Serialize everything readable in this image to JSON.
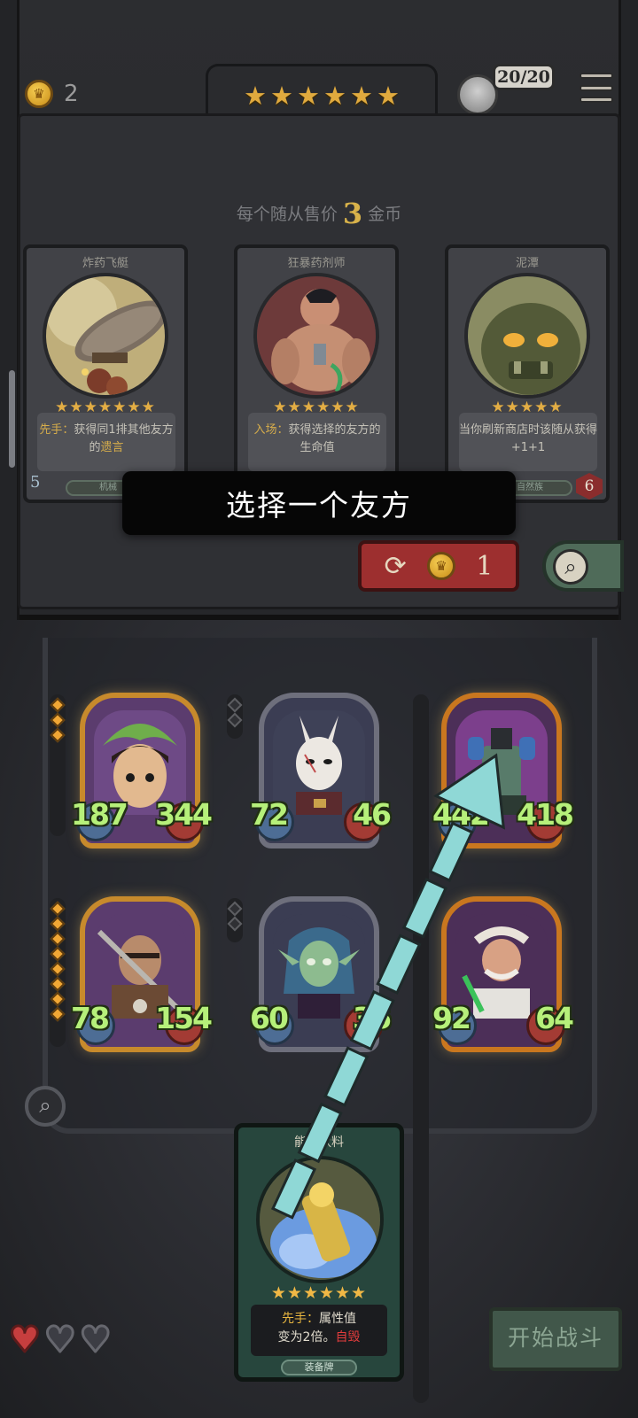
{
  "header": {
    "gold": "2",
    "tier_stars": [
      "★",
      "★",
      "★",
      "★",
      "★",
      "★"
    ],
    "hero_count": "20/20"
  },
  "shop": {
    "price_prefix": "每个随从售价",
    "price_value": "3",
    "price_suffix": "金币",
    "cards": [
      {
        "name": "炸药飞艇",
        "stars": "★★★★★★★",
        "desc_lead": "先手：",
        "desc_body": "获得同1排其他友方的",
        "desc_tail": "遗言",
        "cost": "5",
        "tribe": "机械"
      },
      {
        "name": "狂暴药剂师",
        "stars": "★★★★★★",
        "desc_lead": "入场：",
        "desc_body": "获得选择的友方的生命值",
        "desc_tail": "",
        "cost": "",
        "tribe": ""
      },
      {
        "name": "泥潭",
        "stars": "★★★★★",
        "desc_lead": "",
        "desc_body": "当你刷新商店时该随从获得+1+1",
        "desc_tail": "",
        "hp": "6",
        "tribe": "自然族"
      }
    ],
    "refresh_cost": "1"
  },
  "toast": "选择一个友方",
  "board": {
    "minions": [
      {
        "atk": "187",
        "hp": "344"
      },
      {
        "atk": "72",
        "hp": "46"
      },
      {
        "atk": "442",
        "hp": "418"
      },
      {
        "atk": "78",
        "hp": "154"
      },
      {
        "atk": "60",
        "hp": "36"
      },
      {
        "atk": "92",
        "hp": "64"
      }
    ]
  },
  "equip_card": {
    "name": "能量饮料",
    "stars": "★★★★★★",
    "desc_lead": "先手：",
    "desc_line1": "属性值",
    "desc_line2": "变为2倍。",
    "desc_tail": "自毁",
    "type": "装备牌"
  },
  "start_button": "开始战斗",
  "colors": {
    "accent_gold": "#e0aa3e",
    "stat_green": "#b6f07a",
    "toast_bg": "#060606",
    "refresh_red": "#9d2f2f",
    "arrow_teal": "#8fd8d6"
  },
  "icons": {
    "gold": "crown-coin-icon",
    "menu": "hamburger-icon",
    "refresh": "refresh-icon",
    "search": "magnifier-icon",
    "heart": "heart-icon"
  }
}
